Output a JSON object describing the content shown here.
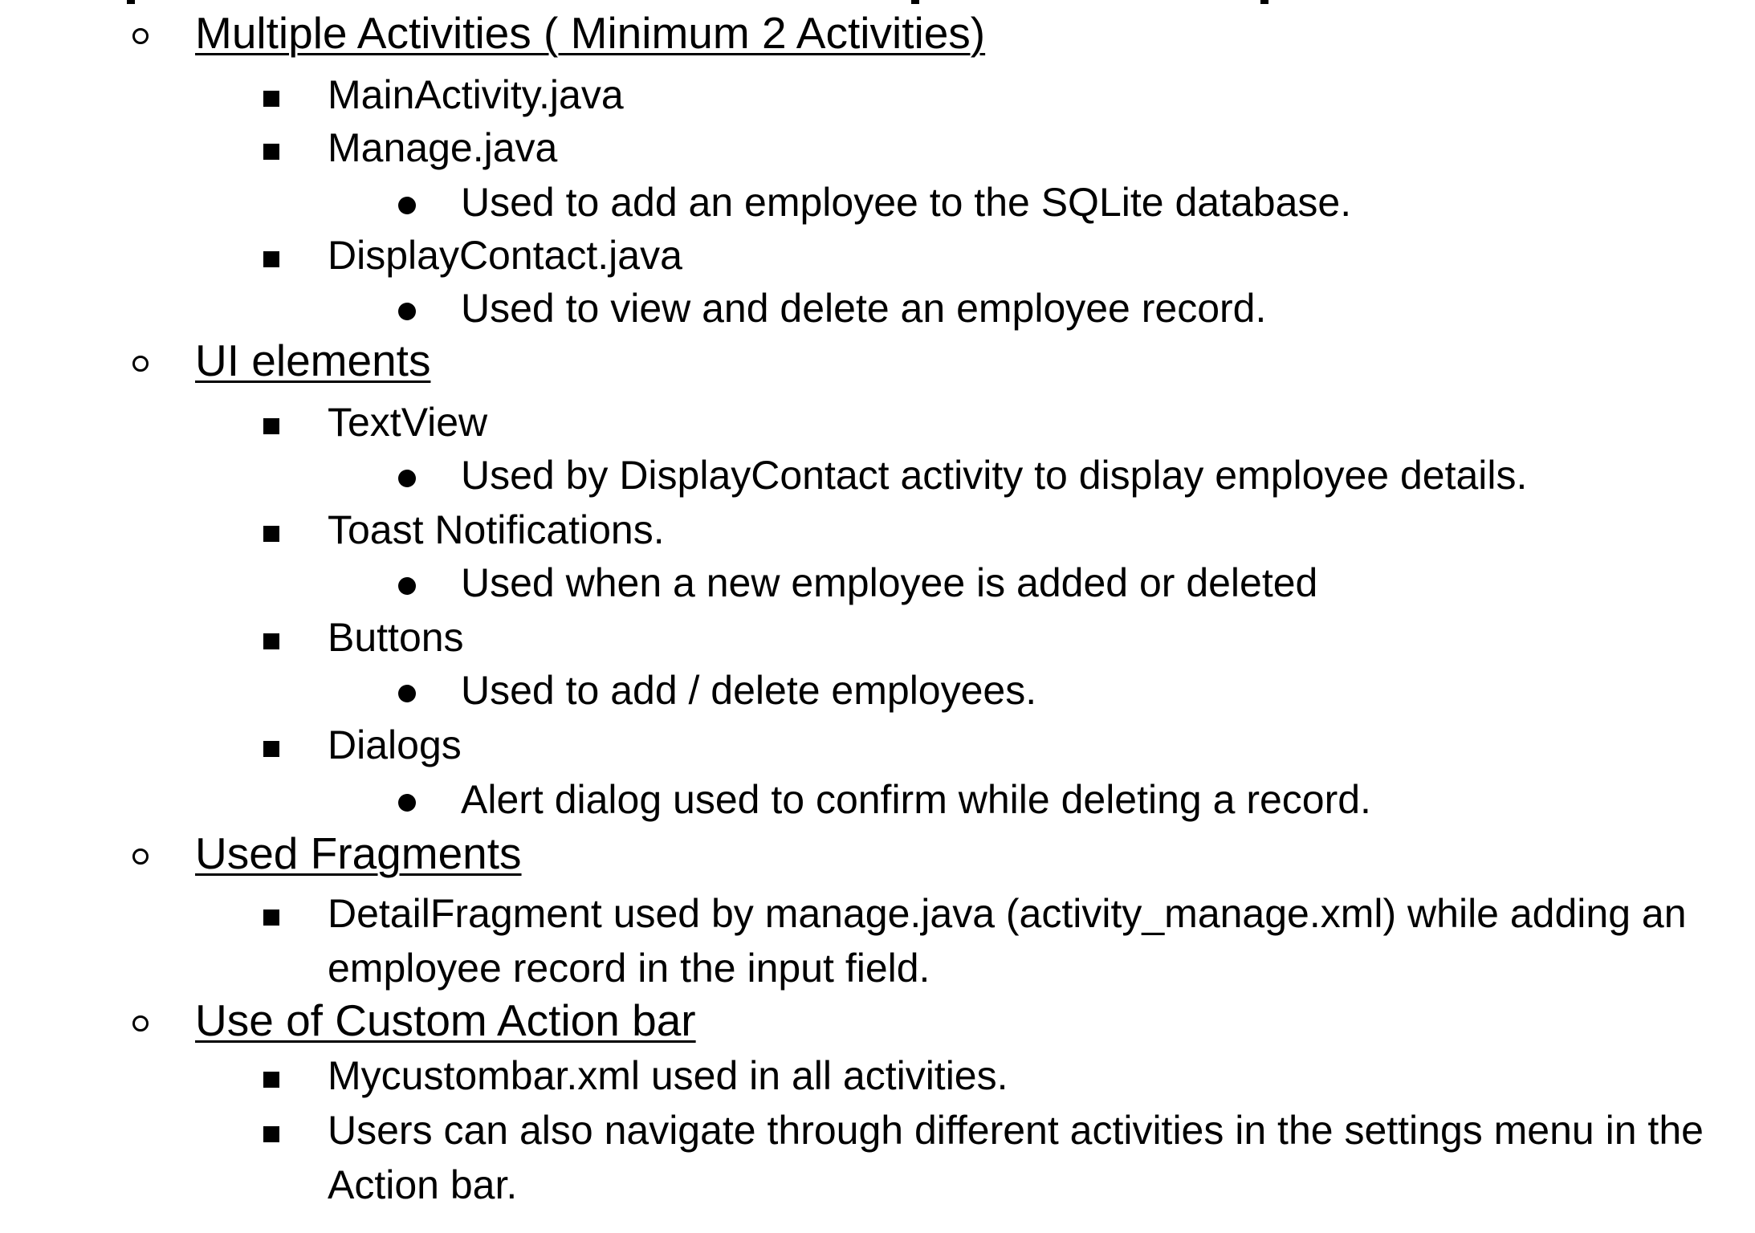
{
  "outline": {
    "multiple_activities": {
      "heading": "Multiple Activities ( Minimum 2 Activities)",
      "items": [
        {
          "label": "MainActivity.java"
        },
        {
          "label": "Manage.java",
          "detail": "Used to add an employee to the SQLite database."
        },
        {
          "label": "DisplayContact.java",
          "detail": "Used to view and delete an employee record."
        }
      ]
    },
    "ui_elements": {
      "heading": "UI elements",
      "items": [
        {
          "label": "TextView",
          "detail": "Used by DisplayContact activity to display employee details."
        },
        {
          "label": "Toast Notifications.",
          "detail": "Used when a new employee is added or deleted"
        },
        {
          "label": "Buttons",
          "detail": "Used to add / delete employees."
        },
        {
          "label": "Dialogs",
          "detail": "Alert dialog used to confirm while deleting a record."
        }
      ]
    },
    "used_fragments": {
      "heading": "Used Fragments",
      "items": [
        {
          "label": "DetailFragment used by manage.java (activity_manage.xml) while adding an employee record in the input field."
        }
      ]
    },
    "custom_action_bar": {
      "heading": "Use of Custom Action bar",
      "items": [
        {
          "label": "Mycustombar.xml used in all activities."
        },
        {
          "label": "Users can also navigate through different activities in the settings menu in the Action bar."
        }
      ]
    }
  }
}
